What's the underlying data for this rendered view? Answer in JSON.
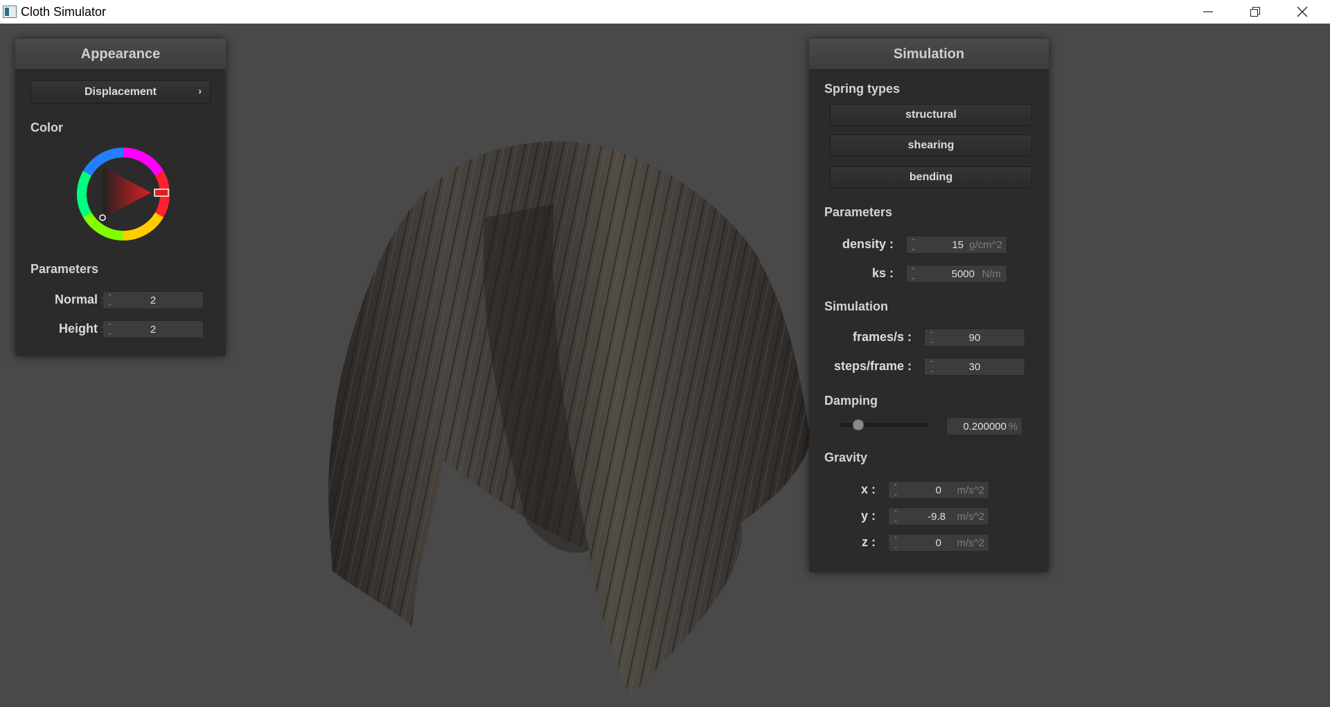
{
  "window": {
    "title": "Cloth Simulator"
  },
  "appearance": {
    "title": "Appearance",
    "shader_select": "Displacement",
    "color_label": "Color",
    "color_value": "#e02020",
    "parameters_label": "Parameters",
    "normal_label": "Normal :",
    "normal_value": "2",
    "height_label": "Height :",
    "height_value": "2"
  },
  "simulation": {
    "title": "Simulation",
    "spring_types_label": "Spring types",
    "spring_buttons": [
      "structural",
      "shearing",
      "bending"
    ],
    "parameters_label": "Parameters",
    "density_label": "density :",
    "density_value": "15",
    "density_unit": "g/cm^2",
    "ks_label": "ks :",
    "ks_value": "5000",
    "ks_unit": "N/m",
    "sim_label": "Simulation",
    "fps_label": "frames/s :",
    "fps_value": "90",
    "steps_label": "steps/frame :",
    "steps_value": "30",
    "damping_label": "Damping",
    "damping_value": "0.200000",
    "damping_unit": "%",
    "damping_slider_fraction": 0.2,
    "gravity_label": "Gravity",
    "gx_label": "x :",
    "gx_value": "0",
    "gy_label": "y :",
    "gy_value": "-9.8",
    "gz_label": "z :",
    "gz_value": "0",
    "gravity_unit": "m/s^2"
  },
  "colors": {
    "background": "#494949",
    "panel": "#2b2b2b"
  }
}
